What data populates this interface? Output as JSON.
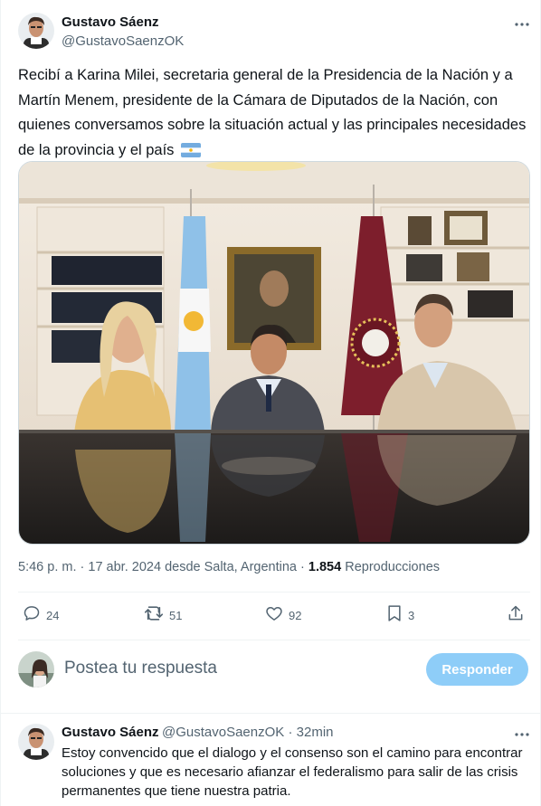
{
  "tweet": {
    "author_name": "Gustavo Sáenz",
    "author_handle": "@GustavoSaenzOK",
    "text": "Recibí a Karina Milei, secretaria general de la Presidencia de la Nación y a Martín Menem, presidente de la Cámara de Diputados de la Nación, con quienes conversamos sobre la situación actual y las principales necesidades de la provincia y el país",
    "flag_icon": "argentina-flag-icon",
    "time": "5:46 p. m.",
    "date": "17 abr. 2024",
    "location": "desde Salta, Argentina",
    "views_count": "1.854",
    "views_label": "Reproducciones",
    "separator": "·"
  },
  "actions": {
    "replies": "24",
    "reposts": "51",
    "likes": "92",
    "bookmarks": "3"
  },
  "composer": {
    "placeholder": "Postea tu respuesta",
    "button_label": "Responder"
  },
  "reply": {
    "author_name": "Gustavo Sáenz",
    "author_handle": "@GustavoSaenzOK",
    "time": "32min",
    "separator": "·",
    "text": "Estoy convencido que el dialogo y el consenso son el camino para encontrar soluciones y que es necesario afianzar el federalismo para salir de las crisis permanentes que tiene nuestra patria."
  },
  "colors": {
    "accent_button": "#8ecdf8",
    "text_primary": "#0f1419",
    "text_secondary": "#536471"
  }
}
